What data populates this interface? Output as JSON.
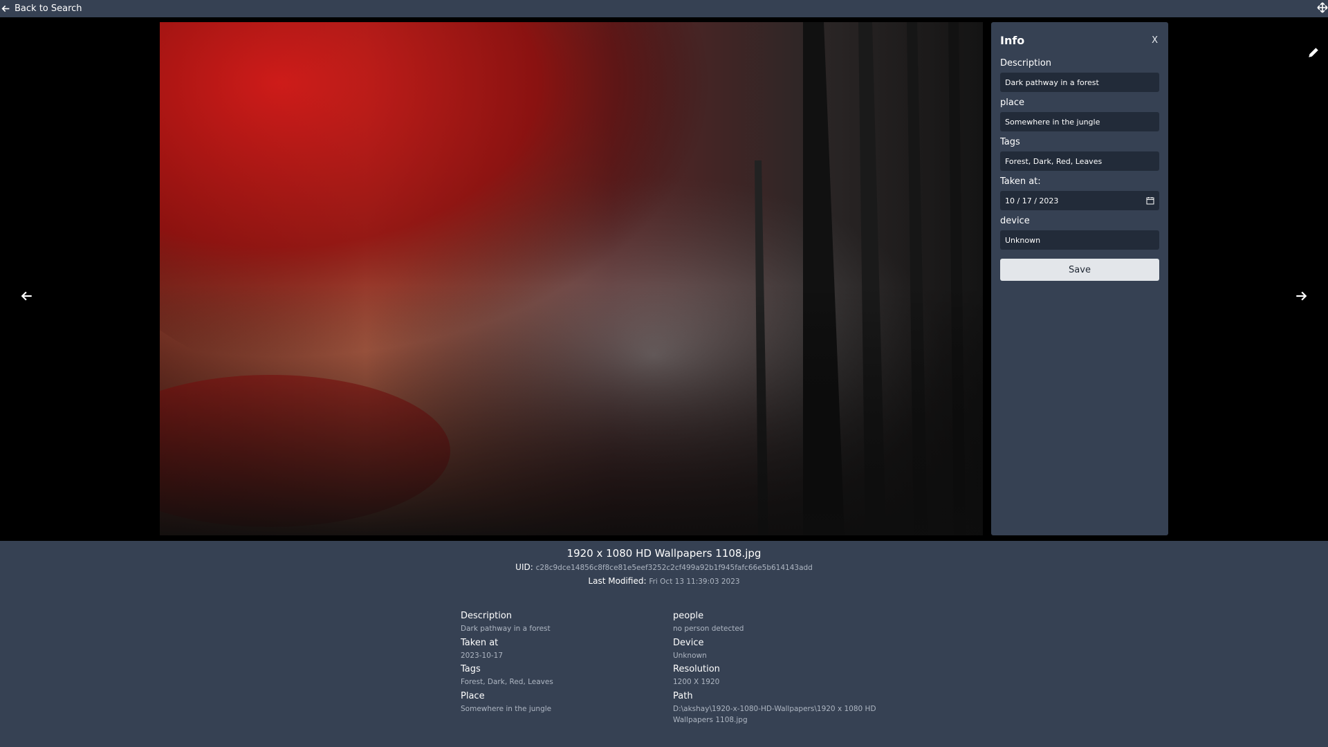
{
  "topbar": {
    "back_label": "Back to Search"
  },
  "info_panel": {
    "title": "Info",
    "close_label": "X",
    "description_label": "Description",
    "description_value": "Dark pathway in a forest",
    "place_label": "place",
    "place_value": "Somewhere in the jungle",
    "tags_label": "Tags",
    "tags_value": "Forest, Dark, Red, Leaves",
    "taken_label": "Taken at:",
    "taken_value": "10 / 17 / 2023",
    "device_label": "device",
    "device_value": "Unknown",
    "save_label": "Save"
  },
  "file": {
    "name": "1920 x 1080 HD Wallpapers 1108.jpg",
    "uid_label": "UID:",
    "uid_value": "c28c9dce14856c8f8ce81e5eef3252c2cf499a92b1f945fafc66e5b614143add",
    "modified_label": "Last Modified:",
    "modified_value": "Fri Oct 13 11:39:03 2023"
  },
  "meta": {
    "description_key": "Description",
    "description_val": "Dark pathway in a forest",
    "taken_key": "Taken at",
    "taken_val": "2023-10-17",
    "tags_key": "Tags",
    "tags_val": "Forest, Dark, Red, Leaves",
    "place_key": "Place",
    "place_val": "Somewhere in the jungle",
    "people_key": "people",
    "people_val": "no person detected",
    "device_key": "Device",
    "device_val": "Unknown",
    "resolution_key": "Resolution",
    "resolution_val": "1200 X 1920",
    "path_key": "Path",
    "path_val": "D:\\akshay\\1920-x-1080-HD-Wallpapers\\1920 x 1080 HD Wallpapers 1108.jpg"
  },
  "icons": {
    "back": "arrow-left-icon",
    "expand": "expand-icon",
    "edit": "pencil-icon",
    "prev": "arrow-left-icon",
    "next": "arrow-right-icon",
    "calendar": "calendar-icon"
  },
  "colors": {
    "panel_bg": "#364153",
    "field_bg": "#222b39",
    "save_bg": "#e3e6ea",
    "muted_text": "#aeb6c2"
  }
}
